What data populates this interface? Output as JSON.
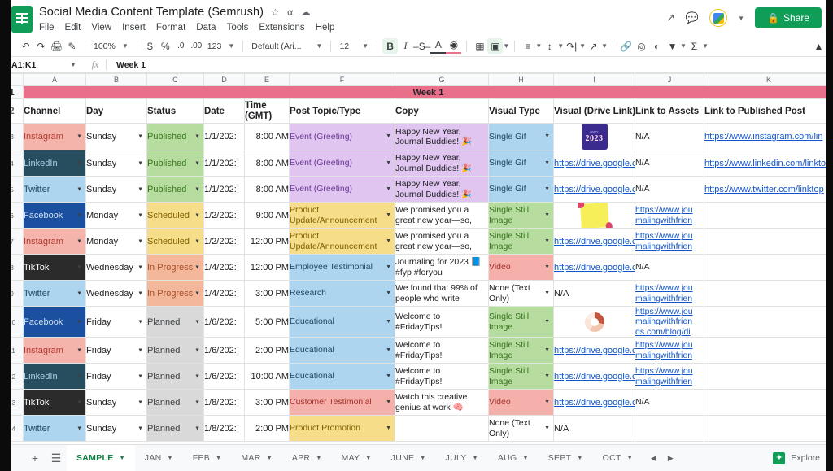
{
  "window": {
    "doc_title": "Social Media Content Template (Semrush)",
    "title_icons": [
      "star-icon",
      "move-to-folder-icon",
      "cloud-status-icon"
    ],
    "menus": [
      "File",
      "Edit",
      "View",
      "Insert",
      "Format",
      "Data",
      "Tools",
      "Extensions",
      "Help"
    ],
    "share_label": "Share",
    "right_icons": [
      "activity-chart-icon",
      "comment-icon",
      "account-avatar-icon"
    ]
  },
  "toolbar": {
    "zoom": "100%",
    "number_format": "123",
    "font": "Default (Ari...",
    "font_size": "12",
    "currency": "$",
    "percent": "%",
    "dec_dec": ".0",
    "dec_inc": ".00",
    "bold": "B",
    "italic": "I",
    "strike": "S",
    "text_color": "A",
    "accent_color": "#e8738f",
    "bold_active_bg": "#e6f4ea"
  },
  "formula_bar": {
    "name_box": "A1:K1",
    "fx": "fx",
    "content": "Week 1"
  },
  "grid": {
    "column_letters": [
      "A",
      "B",
      "C",
      "D",
      "E",
      "F",
      "G",
      "H",
      "I",
      "J",
      "K"
    ],
    "row_numbers": [
      "1",
      "2",
      "3",
      "4",
      "5",
      "6",
      "7",
      "8",
      "9",
      "10",
      "11",
      "12",
      "13",
      "14"
    ],
    "week_banner": "Week 1",
    "week_banner_color": "#e8708a",
    "headers": [
      "Channel",
      "Day",
      "Status",
      "Date",
      "Time (GMT)",
      "Post Topic/Type",
      "Copy",
      "Visual Type",
      "Visual (Drive Link)",
      "Link to Assets",
      "Link to Published Post"
    ],
    "rows": [
      {
        "n": "3",
        "channel": "Instagram",
        "channel_bg": "#f4b3ab",
        "channel_fg": "#b03a2e",
        "day": "Sunday",
        "status": "Published",
        "status_bg": "#b7dca0",
        "status_fg": "#38761d",
        "date": "1/1/202:",
        "time": "8:00 AM",
        "topic": "Event (Greeting)",
        "topic_bg": "#dfc5f0",
        "topic_fg": "#6a3a9a",
        "copy": "Happy New Year, Journal Buddies! 🎉",
        "copy_bg": "#dfc5f0",
        "visual_type": "Single Gif",
        "vt_bg": "#aed5ef",
        "vt_fg": "#1c4966",
        "drive": "",
        "drive_thumb": "new-year-2023-gif-thumbnail",
        "assets": "N/A",
        "assets_link": false,
        "published": "https://www.instagram.com/lin",
        "published_link": true
      },
      {
        "n": "4",
        "channel": "LinkedIn",
        "channel_bg": "#274e5e",
        "channel_fg": "#a8d3ea",
        "day": "Sunday",
        "status": "Published",
        "status_bg": "#b7dca0",
        "status_fg": "#38761d",
        "date": "1/1/202:",
        "time": "8:00 AM",
        "topic": "Event (Greeting)",
        "topic_bg": "#dfc5f0",
        "topic_fg": "#6a3a9a",
        "copy": "Happy New Year, Journal Buddies! 🎉",
        "copy_bg": "#dfc5f0",
        "visual_type": "Single Gif",
        "vt_bg": "#aed5ef",
        "vt_fg": "#1c4966",
        "drive": "https://drive.google.c",
        "drive_thumb": "",
        "assets": "N/A",
        "assets_link": false,
        "published": "https://www.linkedin.com/linkto",
        "published_link": true
      },
      {
        "n": "5",
        "channel": "Twitter",
        "channel_bg": "#aed5ef",
        "channel_fg": "#1c4966",
        "day": "Sunday",
        "status": "Published",
        "status_bg": "#b7dca0",
        "status_fg": "#38761d",
        "date": "1/1/202:",
        "time": "8:00 AM",
        "topic": "Event (Greeting)",
        "topic_bg": "#dfc5f0",
        "topic_fg": "#6a3a9a",
        "copy": "Happy New Year, Journal Buddies! 🎉",
        "copy_bg": "#dfc5f0",
        "visual_type": "Single Gif",
        "vt_bg": "#aed5ef",
        "vt_fg": "#1c4966",
        "drive": "https://drive.google.c",
        "drive_thumb": "",
        "assets": "N/A",
        "assets_link": false,
        "published": "https://www.twitter.com/linktop",
        "published_link": true
      },
      {
        "n": "6",
        "channel": "Facebook",
        "channel_bg": "#1b4fa0",
        "channel_fg": "#cfe0f5",
        "day": "Monday",
        "status": "Scheduled",
        "status_bg": "#f6dd8a",
        "status_fg": "#7f6000",
        "date": "1/2/202:",
        "time": "9:00 AM",
        "topic": "Product Update/Announcement",
        "topic_bg": "#f6dd8a",
        "topic_fg": "#7f6000",
        "copy": "We promised you a great new year—so,",
        "copy_bg": "#ffffff",
        "visual_type": "Single Still Image",
        "vt_bg": "#b7dca0",
        "vt_fg": "#38761d",
        "drive": "",
        "drive_thumb": "yellow-sticky-note-thumbnail",
        "assets": "https://www.jou malingwithfrien",
        "assets_link": true,
        "published": "",
        "published_link": false
      },
      {
        "n": "7",
        "channel": "Instagram",
        "channel_bg": "#f4b3ab",
        "channel_fg": "#b03a2e",
        "day": "Monday",
        "status": "Scheduled",
        "status_bg": "#f6dd8a",
        "status_fg": "#7f6000",
        "date": "1/2/202:",
        "time": "12:00 PM",
        "topic": "Product Update/Announcement",
        "topic_bg": "#f6dd8a",
        "topic_fg": "#7f6000",
        "copy": "We promised you a great new year—so,",
        "copy_bg": "#ffffff",
        "visual_type": "Single Still Image",
        "vt_bg": "#b7dca0",
        "vt_fg": "#38761d",
        "drive": "https://drive.google.c",
        "drive_thumb": "",
        "assets": "https://www.jou malingwithfrien",
        "assets_link": true,
        "published": "",
        "published_link": false
      },
      {
        "n": "8",
        "channel": "TikTok",
        "channel_bg": "#2b2b2b",
        "channel_fg": "#ffffff",
        "day": "Wednesday",
        "status": "In Progress",
        "status_bg": "#f3b79b",
        "status_fg": "#a84f28",
        "date": "1/4/202:",
        "time": "12:00 PM",
        "topic": "Employee Testimonial",
        "topic_bg": "#aed5ef",
        "topic_fg": "#1c4966",
        "copy": "Journaling for 2023 📘 #fyp #foryou",
        "copy_bg": "#ffffff",
        "visual_type": "Video",
        "vt_bg": "#f5b0ab",
        "vt_fg": "#a6342b",
        "drive": "https://drive.google.c",
        "drive_thumb": "",
        "assets": "N/A",
        "assets_link": false,
        "published": "",
        "published_link": false
      },
      {
        "n": "9",
        "channel": "Twitter",
        "channel_bg": "#aed5ef",
        "channel_fg": "#1c4966",
        "day": "Wednesday",
        "status": "In Progress",
        "status_bg": "#f3b79b",
        "status_fg": "#a84f28",
        "date": "1/4/202:",
        "time": "3:00 PM",
        "topic": "Research",
        "topic_bg": "#aed5ef",
        "topic_fg": "#1c4966",
        "copy": "We found that 99% of people who write",
        "copy_bg": "#ffffff",
        "visual_type": "None (Text Only)",
        "vt_bg": "#ffffff",
        "vt_fg": "#202124",
        "drive": "N/A",
        "drive_thumb": "",
        "drive_link": false,
        "assets": "https://www.jou malingwithfrien",
        "assets_link": true,
        "published": "",
        "published_link": false
      },
      {
        "n": "10",
        "channel": "Facebook",
        "channel_bg": "#1b4fa0",
        "channel_fg": "#cfe0f5",
        "day": "Friday",
        "status": "Planned",
        "status_bg": "#d9d9d9",
        "status_fg": "#3c4043",
        "date": "1/6/202:",
        "time": "5:00 PM",
        "topic": "Educational",
        "topic_bg": "#aed5ef",
        "topic_fg": "#1c4966",
        "copy": "Welcome to #FridayTips!",
        "copy_bg": "#ffffff",
        "visual_type": "Single Still Image",
        "vt_bg": "#b7dca0",
        "vt_fg": "#38761d",
        "drive": "",
        "drive_thumb": "donut-chart-thumbnail",
        "assets": "https://www.jou malingwithfrien ds.com/blog/di",
        "assets_link": true,
        "published": "",
        "published_link": false
      },
      {
        "n": "11",
        "channel": "Instagram",
        "channel_bg": "#f4b3ab",
        "channel_fg": "#b03a2e",
        "day": "Friday",
        "status": "Planned",
        "status_bg": "#d9d9d9",
        "status_fg": "#3c4043",
        "date": "1/6/202:",
        "time": "2:00 PM",
        "topic": "Educational",
        "topic_bg": "#aed5ef",
        "topic_fg": "#1c4966",
        "copy": "Welcome to #FridayTips!",
        "copy_bg": "#ffffff",
        "visual_type": "Single Still Image",
        "vt_bg": "#b7dca0",
        "vt_fg": "#38761d",
        "drive": "https://drive.google.c",
        "drive_thumb": "",
        "assets": "https://www.jou malingwithfrien",
        "assets_link": true,
        "published": "",
        "published_link": false
      },
      {
        "n": "12",
        "channel": "LinkedIn",
        "channel_bg": "#274e5e",
        "channel_fg": "#a8d3ea",
        "day": "Friday",
        "status": "Planned",
        "status_bg": "#d9d9d9",
        "status_fg": "#3c4043",
        "date": "1/6/202:",
        "time": "10:00 AM",
        "topic": "Educational",
        "topic_bg": "#aed5ef",
        "topic_fg": "#1c4966",
        "copy": "Welcome to #FridayTips!",
        "copy_bg": "#ffffff",
        "visual_type": "Single Still Image",
        "vt_bg": "#b7dca0",
        "vt_fg": "#38761d",
        "drive": "https://drive.google.c",
        "drive_thumb": "",
        "assets": "https://www.jou malingwithfrien",
        "assets_link": true,
        "published": "",
        "published_link": false
      },
      {
        "n": "13",
        "channel": "TikTok",
        "channel_bg": "#2b2b2b",
        "channel_fg": "#ffffff",
        "day": "Sunday",
        "status": "Planned",
        "status_bg": "#d9d9d9",
        "status_fg": "#3c4043",
        "date": "1/8/202:",
        "time": "3:00 PM",
        "topic": "Customer Testimonial",
        "topic_bg": "#f5b0ab",
        "topic_fg": "#a6342b",
        "copy": "Watch this creative genius at work 🧠",
        "copy_bg": "#ffffff",
        "visual_type": "Video",
        "vt_bg": "#f5b0ab",
        "vt_fg": "#a6342b",
        "drive": "https://drive.google.c",
        "drive_thumb": "",
        "assets": "N/A",
        "assets_link": false,
        "published": "",
        "published_link": false
      },
      {
        "n": "14",
        "channel": "Twitter",
        "channel_bg": "#aed5ef",
        "channel_fg": "#1c4966",
        "day": "Sunday",
        "status": "Planned",
        "status_bg": "#d9d9d9",
        "status_fg": "#3c4043",
        "date": "1/8/202:",
        "time": "2:00 PM",
        "topic": "Product Promotion",
        "topic_bg": "#f6dd8a",
        "topic_fg": "#7f6000",
        "copy": "",
        "copy_bg": "#ffffff",
        "visual_type": "None (Text Only)",
        "vt_bg": "#ffffff",
        "vt_fg": "#202124",
        "drive": "N/A",
        "drive_thumb": "",
        "drive_link": false,
        "assets": "",
        "assets_link": false,
        "published": "",
        "published_link": false
      }
    ]
  },
  "sheet_tabs": {
    "add_label": "+",
    "all_sheets_icon": "all-sheets-icon",
    "tabs": [
      {
        "label": "SAMPLE",
        "active": true
      },
      {
        "label": "JAN",
        "active": false
      },
      {
        "label": "FEB",
        "active": false
      },
      {
        "label": "MAR",
        "active": false
      },
      {
        "label": "APR",
        "active": false
      },
      {
        "label": "MAY",
        "active": false
      },
      {
        "label": "JUNE",
        "active": false
      },
      {
        "label": "JULY",
        "active": false
      },
      {
        "label": "AUG",
        "active": false
      },
      {
        "label": "SEPT",
        "active": false
      },
      {
        "label": "OCT",
        "active": false
      }
    ],
    "explore_label": "Explore"
  }
}
